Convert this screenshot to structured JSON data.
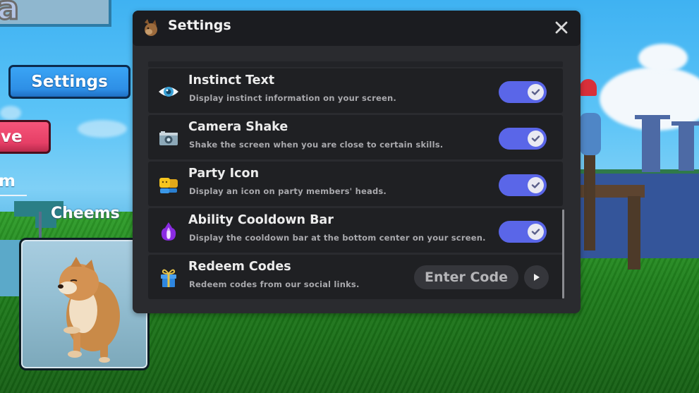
{
  "hud": {
    "settings_button": "Settings",
    "red_button_partial": "ve",
    "m_label_partial": "m",
    "pet_name": "Cheems"
  },
  "modal": {
    "title": "Settings",
    "header_icon": "cat-head-icon",
    "close_icon": "close-icon",
    "settings": [
      {
        "id": "instinct-text",
        "icon": "eye-icon",
        "title": "Instinct Text",
        "description": "Display instinct information on your screen.",
        "type": "toggle",
        "enabled": true
      },
      {
        "id": "camera-shake",
        "icon": "camera-icon",
        "title": "Camera Shake",
        "description": "Shake the screen when you are close to certain skills.",
        "type": "toggle",
        "enabled": true
      },
      {
        "id": "party-icon",
        "icon": "party-members-icon",
        "title": "Party Icon",
        "description": "Display an icon on party members' heads.",
        "type": "toggle",
        "enabled": true
      },
      {
        "id": "ability-cooldown-bar",
        "icon": "purple-flame-icon",
        "title": "Ability Cooldown Bar",
        "description": "Display the cooldown bar at the bottom center on your screen.",
        "type": "toggle",
        "enabled": true
      },
      {
        "id": "redeem-codes",
        "icon": "gift-icon",
        "title": "Redeem Codes",
        "description": "Redeem codes from our social links.",
        "type": "input",
        "input_value": "",
        "input_placeholder": "Enter Code",
        "submit_icon": "play-arrow-icon"
      }
    ]
  },
  "colors": {
    "modal_bg": "#2a2b2f",
    "header_bg": "#1b1c20",
    "row_bg": "#1f2023",
    "toggle_on": "#5a66e8",
    "hud_blue": "#2e8fe6",
    "hud_red": "#e63f66"
  }
}
